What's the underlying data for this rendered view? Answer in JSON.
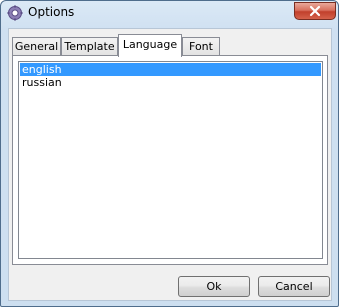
{
  "window": {
    "title": "Options",
    "app_icon": "gear-icon",
    "close_icon": "close-icon"
  },
  "tabs": [
    {
      "label": "General",
      "active": false
    },
    {
      "label": "Template",
      "active": false
    },
    {
      "label": "Language",
      "active": true
    },
    {
      "label": "Font",
      "active": false
    }
  ],
  "language_list": {
    "items": [
      {
        "label": "english",
        "selected": true
      },
      {
        "label": "russian",
        "selected": false
      }
    ]
  },
  "buttons": {
    "ok_label": "Ok",
    "cancel_label": "Cancel"
  },
  "colors": {
    "selection": "#3399ff",
    "close_button": "#c1402c",
    "title_bar": "#cfe0f1"
  }
}
